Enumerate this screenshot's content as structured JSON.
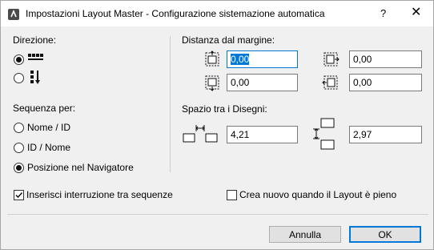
{
  "window": {
    "title": "Impostazioni Layout Master - Configurazione sistemazione automatica",
    "help_label": "?",
    "close_label": "✕"
  },
  "direction": {
    "heading": "Direzione:",
    "options": [
      {
        "icon": "horizontal-order-icon",
        "checked": true
      },
      {
        "icon": "vertical-order-icon",
        "checked": false
      }
    ]
  },
  "sequence": {
    "heading": "Sequenza per:",
    "options": [
      {
        "label": "Nome / ID",
        "checked": false
      },
      {
        "label": "ID / Nome",
        "checked": false
      },
      {
        "label": "Posizione nel Navigatore",
        "checked": true
      }
    ]
  },
  "margins": {
    "heading": "Distanza dal margine:",
    "top": "0,00",
    "right": "0,00",
    "bottom": "0,00",
    "left": "0,00"
  },
  "spacing": {
    "heading": "Spazio tra i Disegni:",
    "horizontal": "4,21",
    "vertical": "2,97"
  },
  "options": {
    "break_between_sequences": {
      "label": "Inserisci interruzione tra sequenze",
      "checked": true
    },
    "create_new_when_full": {
      "label": "Crea nuovo quando il Layout è pieno",
      "checked": false
    }
  },
  "buttons": {
    "cancel": "Annulla",
    "ok": "OK"
  },
  "colors": {
    "focus_accent": "#0078d7",
    "dialog_background": "#f0f0f0"
  }
}
